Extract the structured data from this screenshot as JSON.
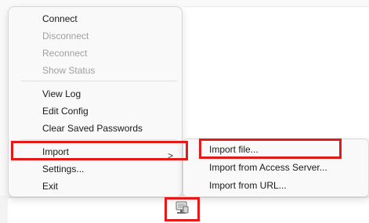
{
  "menu": {
    "items": [
      {
        "label": "Connect",
        "enabled": true
      },
      {
        "label": "Disconnect",
        "enabled": false
      },
      {
        "label": "Reconnect",
        "enabled": false
      },
      {
        "label": "Show Status",
        "enabled": false
      },
      {
        "label": "View Log",
        "enabled": true
      },
      {
        "label": "Edit Config",
        "enabled": true
      },
      {
        "label": "Clear Saved Passwords",
        "enabled": true
      },
      {
        "label": "Import",
        "enabled": true
      },
      {
        "label": "Settings...",
        "enabled": true
      },
      {
        "label": "Exit",
        "enabled": true
      }
    ],
    "submenu_arrow": ">"
  },
  "submenu": {
    "items": [
      {
        "label": "Import file..."
      },
      {
        "label": "Import from Access Server..."
      },
      {
        "label": "Import from URL..."
      }
    ]
  },
  "colors": {
    "highlight": "#e21a1a",
    "disabled_text": "#a0a0a0"
  },
  "icons": {
    "tray": "network-monitor-icon"
  }
}
